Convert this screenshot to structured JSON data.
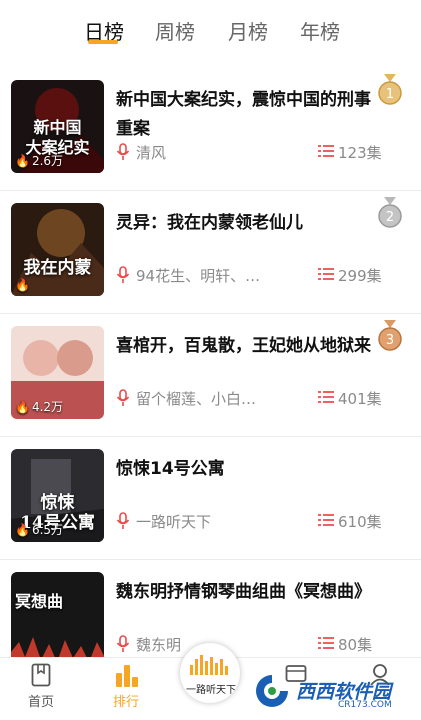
{
  "tabs": [
    {
      "label": "日榜",
      "active": true
    },
    {
      "label": "周榜",
      "active": false
    },
    {
      "label": "月榜",
      "active": false
    },
    {
      "label": "年榜",
      "active": false
    }
  ],
  "items": [
    {
      "title": "新中国大案纪实，震惊中国的刑事重案",
      "author": "清风",
      "episodes": "123集",
      "plays": "2.6万",
      "cover_text": "新中国\n大案纪实",
      "rank": "1",
      "medal_color": "#d9a441"
    },
    {
      "title": "灵异：我在内蒙领老仙儿",
      "author": "94花生、明轩、…",
      "episodes": "299集",
      "plays": "",
      "cover_text": "我在内蒙",
      "rank": "2",
      "medal_color": "#a8a8a8"
    },
    {
      "title": "喜棺开，百鬼散，王妃她从地狱来",
      "author": "留个榴莲、小白…",
      "episodes": "401集",
      "plays": "4.2万",
      "cover_text": "",
      "rank": "3",
      "medal_color": "#d28a4e"
    },
    {
      "title": "惊悚14号公寓",
      "author": "一路听天下",
      "episodes": "610集",
      "plays": "6.5万",
      "cover_text": "惊悚\n14号公寓",
      "rank": "",
      "medal_color": ""
    },
    {
      "title": "魏东明抒情钢琴曲组曲《冥想曲》",
      "author": "魏东明",
      "episodes": "80集",
      "plays": "",
      "cover_text": "冥想曲",
      "rank": "",
      "medal_color": ""
    }
  ],
  "bottom_nav": [
    {
      "label": "首页",
      "icon": "book-icon",
      "active": false
    },
    {
      "label": "排行",
      "icon": "ranking-icon",
      "active": true
    },
    {
      "label": "",
      "icon": "folder-icon",
      "active": false
    },
    {
      "label": "",
      "icon": "user-icon",
      "active": false
    }
  ],
  "center_button": {
    "label": "一路听天下"
  },
  "watermark": {
    "text": "西西软件园",
    "sub": "CR173.COM"
  },
  "colors": {
    "accent": "#f6a623",
    "list_icon": "#e94b4b",
    "mic_icon": "#e94b4b"
  }
}
